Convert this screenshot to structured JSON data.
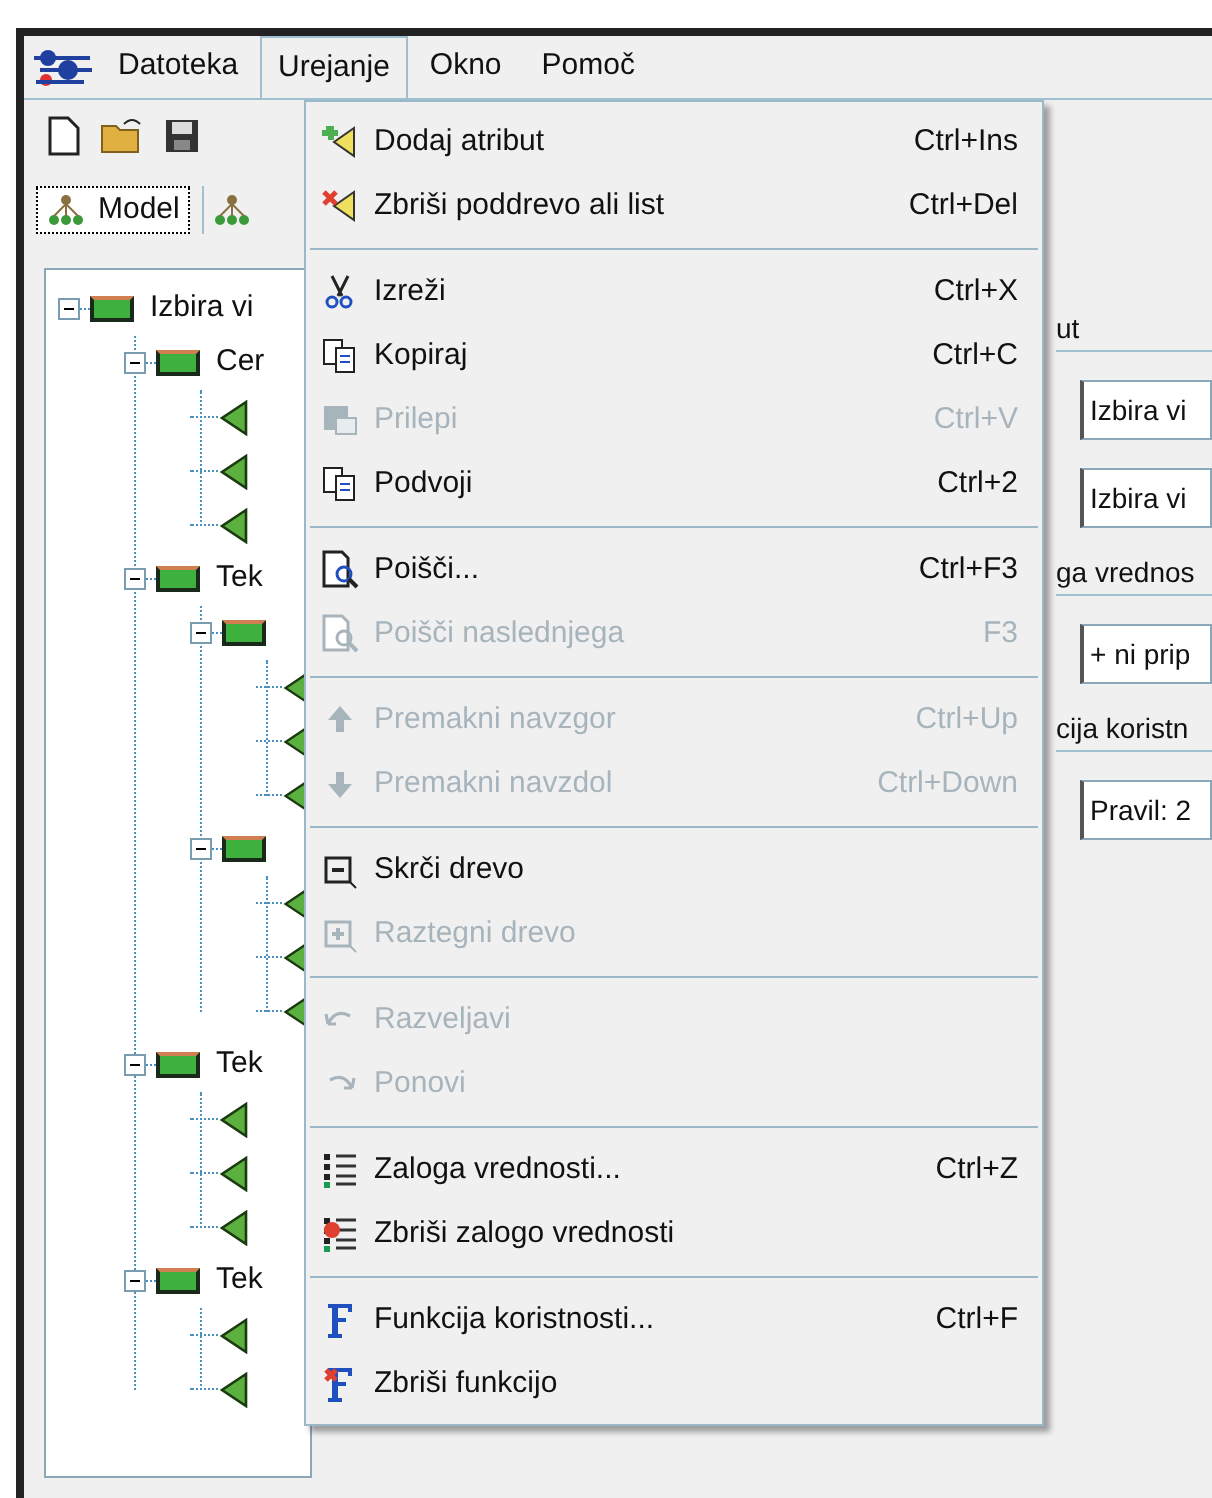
{
  "menu_bar": [
    {
      "label": "Datoteka",
      "selected": false
    },
    {
      "label": "Urejanje",
      "selected": true
    },
    {
      "label": "Okno",
      "selected": false
    },
    {
      "label": "Pomoč",
      "selected": false
    }
  ],
  "tabs": [
    {
      "label": "Model",
      "selected": true
    },
    {
      "selected": false
    }
  ],
  "tree": [
    {
      "kind": "group",
      "label": "Izbira vi",
      "expanded": true,
      "children": [
        {
          "kind": "group",
          "label": "Cer",
          "expanded": true,
          "children": [
            {
              "kind": "leaf"
            },
            {
              "kind": "leaf"
            },
            {
              "kind": "leaf"
            }
          ]
        },
        {
          "kind": "group",
          "label": "Tek",
          "expanded": true,
          "children": [
            {
              "kind": "group",
              "expanded": true,
              "children": [
                {
                  "kind": "leaf"
                },
                {
                  "kind": "leaf"
                },
                {
                  "kind": "leaf"
                }
              ]
            },
            {
              "kind": "group",
              "expanded": true,
              "children": [
                {
                  "kind": "leaf"
                },
                {
                  "kind": "leaf"
                },
                {
                  "kind": "leaf"
                }
              ]
            }
          ]
        },
        {
          "kind": "group",
          "label": "Tek",
          "expanded": true,
          "children": [
            {
              "kind": "leaf"
            },
            {
              "kind": "leaf"
            },
            {
              "kind": "leaf"
            }
          ]
        },
        {
          "kind": "group",
          "label": "Tek",
          "expanded": true,
          "children": [
            {
              "kind": "leaf"
            },
            {
              "kind": "leaf"
            }
          ]
        }
      ]
    }
  ],
  "details": [
    {
      "kind": "caption",
      "text": "ut"
    },
    {
      "kind": "field",
      "value": "Izbira vi"
    },
    {
      "kind": "field",
      "value": "Izbira vi"
    },
    {
      "kind": "caption",
      "text": "ga vrednos"
    },
    {
      "kind": "field",
      "value": "+ ni prip"
    },
    {
      "kind": "caption",
      "text": "cija koristn"
    },
    {
      "kind": "field",
      "value": "Pravil: 2"
    }
  ],
  "edit_menu": [
    {
      "kind": "item",
      "label": "Dodaj atribut",
      "shortcut": "Ctrl+Ins",
      "disabled": false
    },
    {
      "kind": "item",
      "label": "Zbriši poddrevo ali list",
      "shortcut": "Ctrl+Del",
      "disabled": false
    },
    {
      "kind": "separator"
    },
    {
      "kind": "item",
      "label": "Izreži",
      "shortcut": "Ctrl+X",
      "disabled": false
    },
    {
      "kind": "item",
      "label": "Kopiraj",
      "shortcut": "Ctrl+C",
      "disabled": false
    },
    {
      "kind": "item",
      "label": "Prilepi",
      "shortcut": "Ctrl+V",
      "disabled": true
    },
    {
      "kind": "item",
      "label": "Podvoji",
      "shortcut": "Ctrl+2",
      "disabled": false
    },
    {
      "kind": "separator"
    },
    {
      "kind": "item",
      "label": "Poišči...",
      "shortcut": "Ctrl+F3",
      "disabled": false
    },
    {
      "kind": "item",
      "label": "Poišči naslednjega",
      "shortcut": "F3",
      "disabled": true
    },
    {
      "kind": "separator"
    },
    {
      "kind": "item",
      "label": "Premakni navzgor",
      "shortcut": "Ctrl+Up",
      "disabled": true
    },
    {
      "kind": "item",
      "label": "Premakni navzdol",
      "shortcut": "Ctrl+Down",
      "disabled": true
    },
    {
      "kind": "separator"
    },
    {
      "kind": "item",
      "label": "Skrči drevo",
      "disabled": false
    },
    {
      "kind": "item",
      "label": "Raztegni drevo",
      "disabled": true
    },
    {
      "kind": "separator"
    },
    {
      "kind": "item",
      "label": "Razveljavi",
      "disabled": true
    },
    {
      "kind": "item",
      "label": "Ponovi",
      "disabled": true
    },
    {
      "kind": "separator"
    },
    {
      "kind": "item",
      "label": "Zaloga vrednosti...",
      "shortcut": "Ctrl+Z",
      "disabled": false
    },
    {
      "kind": "item",
      "label": "Zbriši zalogo vrednosti",
      "disabled": false
    },
    {
      "kind": "separator"
    },
    {
      "kind": "item",
      "label": "Funkcija koristnosti...",
      "shortcut": "Ctrl+F",
      "disabled": false
    },
    {
      "kind": "item",
      "label": "Zbriši funkcijo",
      "disabled": false
    }
  ]
}
